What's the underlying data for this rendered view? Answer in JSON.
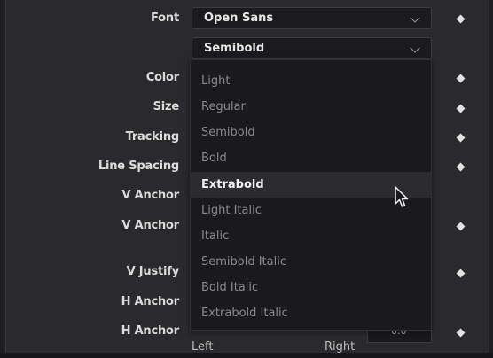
{
  "labels": {
    "font": "Font",
    "color": "Color",
    "size": "Size",
    "tracking": "Tracking",
    "line_spacing": "Line Spacing",
    "v_anchor_1": "V Anchor",
    "v_anchor_2": "V Anchor",
    "v_justify": "V Justify",
    "h_anchor_1": "H Anchor",
    "h_anchor_2": "H Anchor"
  },
  "font_select": {
    "value": "Open Sans"
  },
  "style_select": {
    "value": "Semibold"
  },
  "style_menu": {
    "items": [
      "Light",
      "Regular",
      "Semibold",
      "Bold",
      "Extrabold",
      "Light Italic",
      "Italic",
      "Semibold Italic",
      "Bold Italic",
      "Extrabold Italic"
    ],
    "highlighted": "Extrabold"
  },
  "h_anchor_options": {
    "left": "Left",
    "right": "Right"
  },
  "h_anchor_value": "0.0",
  "icons": {
    "chevron": "chevron-down-icon",
    "keyframe": "keyframe-diamond-icon",
    "cursor": "mouse-pointer-icon"
  },
  "colors": {
    "background": "#2a2a2d",
    "menu_bg": "#1a1a1c",
    "highlight": "#2c2c30"
  }
}
